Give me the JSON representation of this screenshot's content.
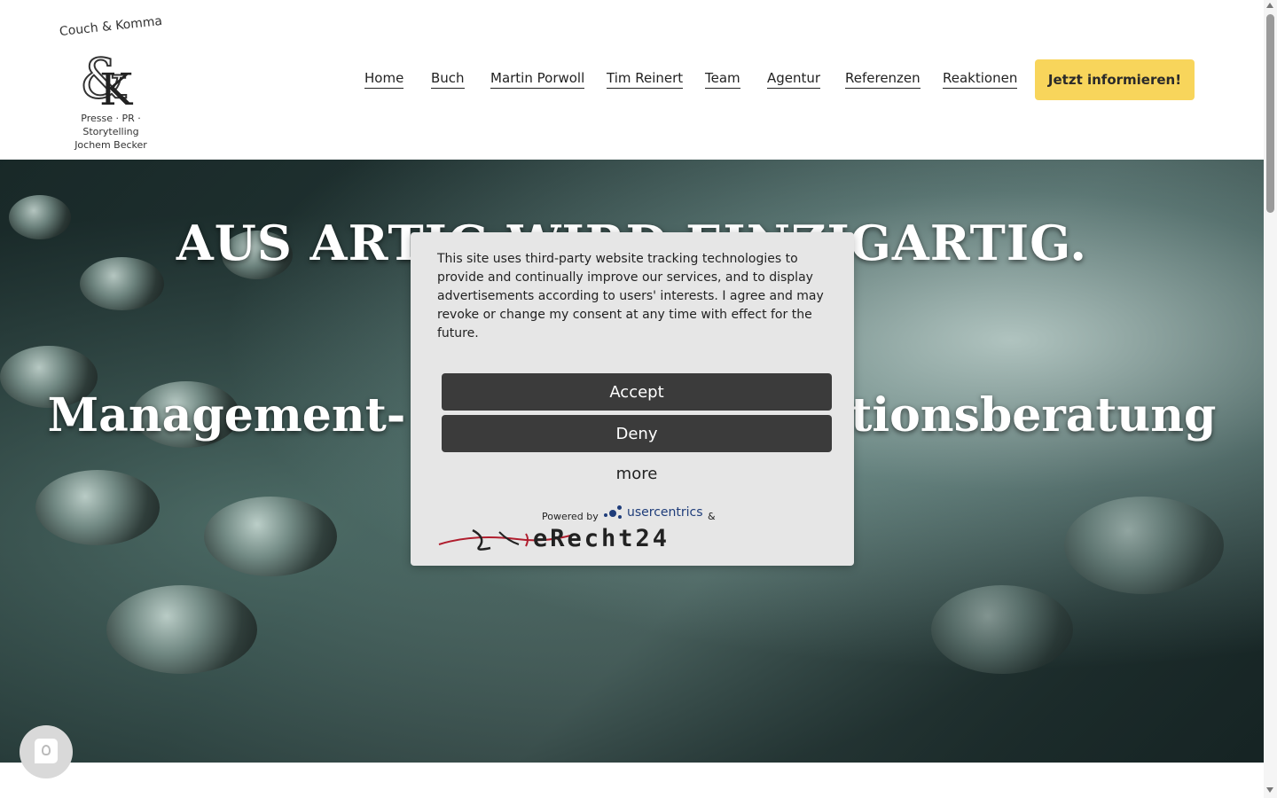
{
  "logo": {
    "top_text": "Couch & Komma",
    "tagline_line1": "Presse · PR · Storytelling",
    "tagline_line2": "Jochem Becker"
  },
  "nav": {
    "items": [
      {
        "label": "Home"
      },
      {
        "label": "Buch"
      },
      {
        "label": "Martin Porwoll"
      },
      {
        "label": "Tim Reinert"
      },
      {
        "label": "Team"
      },
      {
        "label": "Agentur"
      },
      {
        "label": "Referenzen"
      },
      {
        "label": "Reaktionen"
      }
    ],
    "cta_label": "Jetzt informieren!",
    "cta_color": "#f8d55b"
  },
  "hero": {
    "title": "AUS ARTIG WIRD EINZIGARTIG.",
    "subtitle": "Management- und Kommunikationsberatung"
  },
  "consent": {
    "text": "This site uses third-party website tracking technologies to provide and continually improve our services, and to display advertisements according to users' interests. I agree and may revoke or change my consent at any time with effect for the future.",
    "accept_label": "Accept",
    "deny_label": "Deny",
    "more_label": "more",
    "powered_by": "Powered by",
    "usercentrics": "usercentrics",
    "ampersand": "&",
    "erecht": "eRecht24",
    "button_color": "#3b3b3b",
    "background_color": "#e6e6e6"
  },
  "privacy_button": {
    "icon": "fingerprint-icon"
  }
}
